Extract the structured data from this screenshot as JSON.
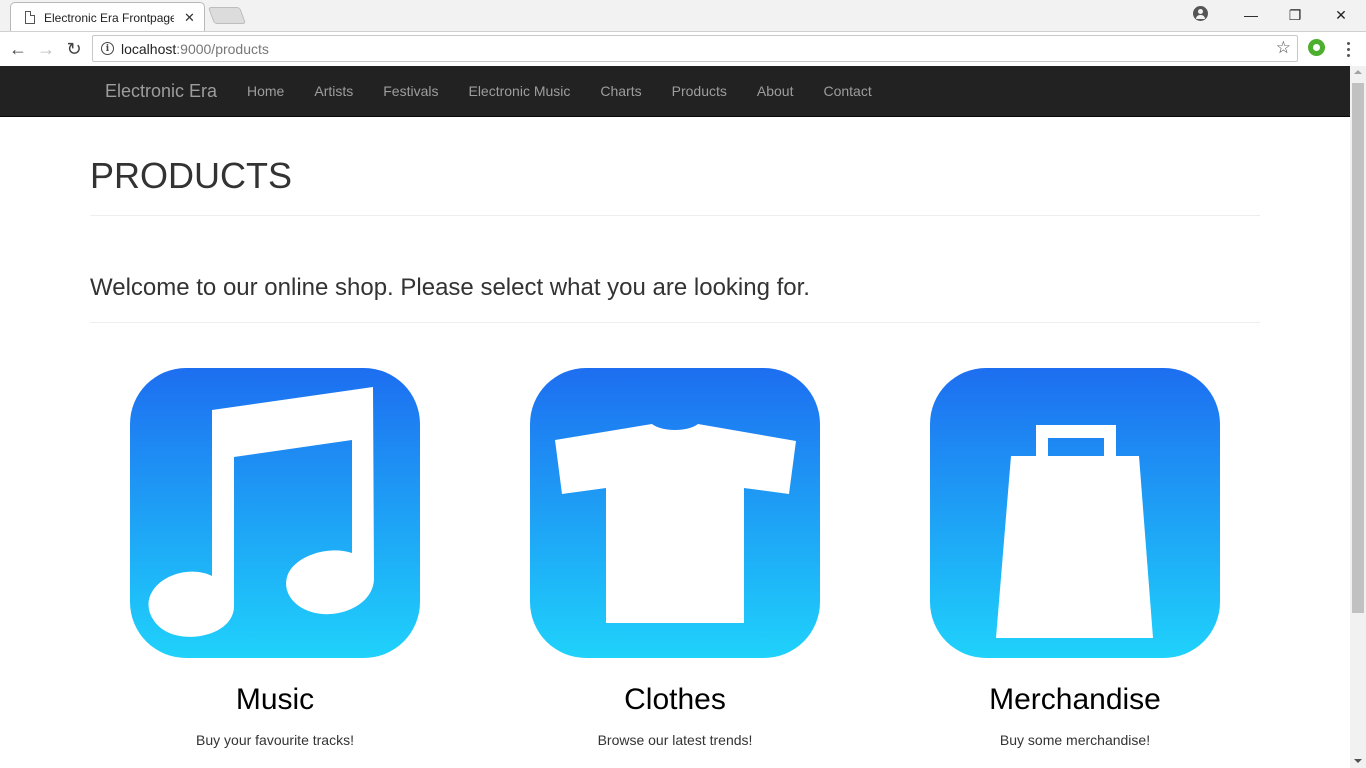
{
  "browser": {
    "tab_title": "Electronic Era Frontpage",
    "tab_close": "✕",
    "url_host": "localhost",
    "url_path": ":9000/products",
    "window_controls": {
      "minimize": "—",
      "restore": "❐",
      "close": "✕"
    },
    "nav": {
      "back": "←",
      "forward": "→",
      "reload": "↻"
    },
    "star": "☆"
  },
  "site": {
    "brand": "Electronic Era",
    "nav_links": [
      "Home",
      "Artists",
      "Festivals",
      "Electronic Music",
      "Charts",
      "Products",
      "About",
      "Contact"
    ],
    "navbar_color": "#222222"
  },
  "page": {
    "title": "PRODUCTS",
    "lead": "Welcome to our online shop. Please select what you are looking for."
  },
  "products": [
    {
      "icon": "music-note-icon",
      "title": "Music",
      "description": "Buy your favourite tracks!"
    },
    {
      "icon": "t-shirt-icon",
      "title": "Clothes",
      "description": "Browse our latest trends!"
    },
    {
      "icon": "shopping-bag-icon",
      "title": "Merchandise",
      "description": "Buy some merchandise!"
    }
  ],
  "colors": {
    "tile_gradient_top": "#1d6ef0",
    "tile_gradient_bottom": "#1fd2fb"
  }
}
